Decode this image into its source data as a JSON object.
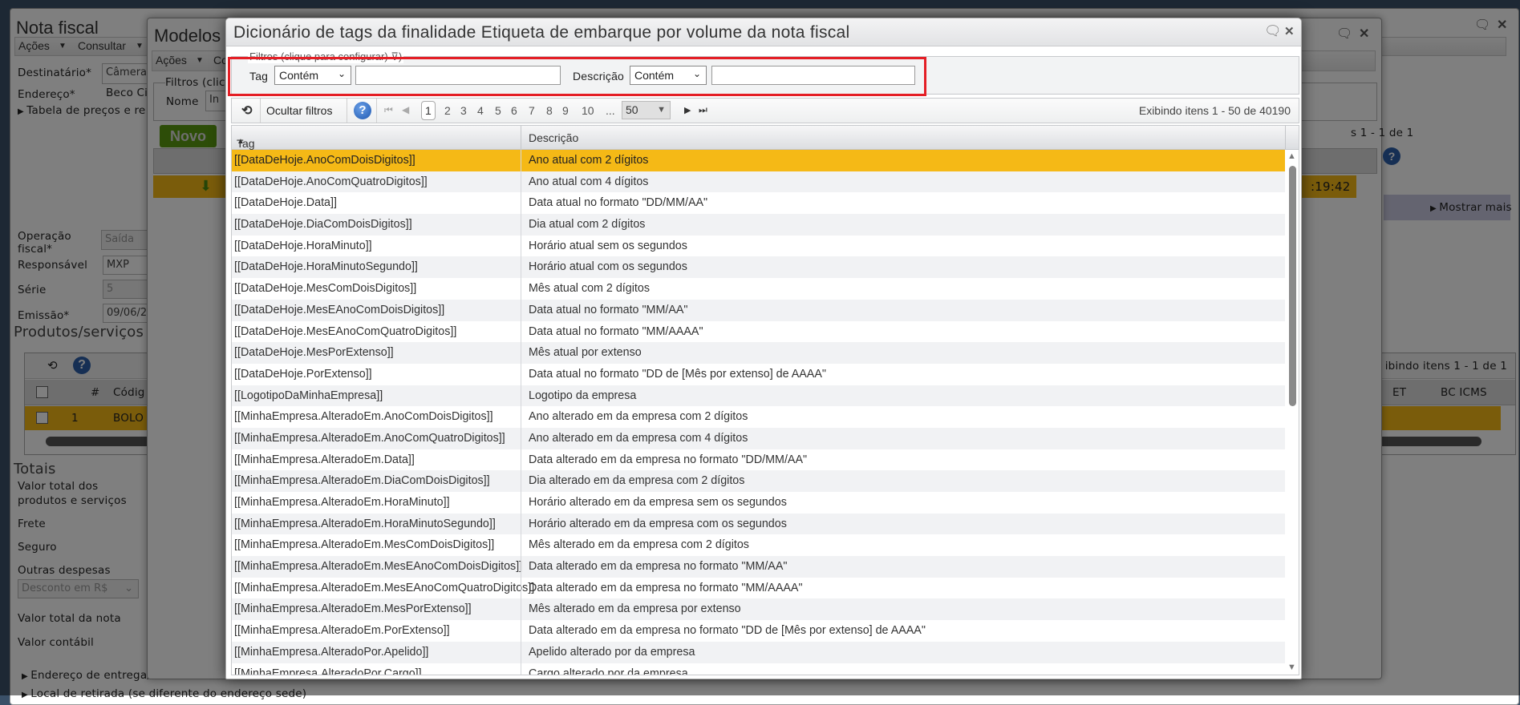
{
  "nota_fiscal": {
    "title": "Nota fiscal",
    "menu": [
      "Ações",
      "Consultar"
    ],
    "fields": {
      "destinatario_label": "Destinatário*",
      "destinatario_value": "Câmera",
      "endereco_label": "Endereço*",
      "endereco_value": "Beco Ci",
      "tabela_precos": "Tabela de preços e re",
      "operacao_label_1": "Operação",
      "operacao_label_2": "fiscal*",
      "operacao_value": "Saída",
      "responsavel_label": "Responsável",
      "responsavel_value": "MXP",
      "serie_label": "Série",
      "serie_value": "5",
      "emissao_label": "Emissão*",
      "emissao_value": "09/06/2"
    },
    "produtos": {
      "title": "Produtos/serviços",
      "col_num": "#",
      "col_codigo": "Códig",
      "row_num": "1",
      "row_codigo": "BOLO",
      "count": "ibindo itens 1 - 1 de 1",
      "col_et": "ET",
      "col_bc_icms": "BC ICMS"
    },
    "mostrar_mais": "Mostrar mais",
    "totais": {
      "title": "Totais",
      "valor_produtos_1": "Valor total dos",
      "valor_produtos_2": "produtos e serviços",
      "frete": "Frete",
      "seguro": "Seguro",
      "outras": "Outras despesas",
      "desconto": "Desconto em R$",
      "valor_nota": "Valor total da nota",
      "valor_contabil": "Valor contábil"
    },
    "endereco_entrega": "Endereço de entrega/",
    "local_retirada": "Local de retirada (se diferente do endereço sede)"
  },
  "modelos": {
    "title": "Modelos",
    "menu": [
      "Ações",
      "Co"
    ],
    "filtros": "Filtros (clic",
    "nome_label": "Nome",
    "nome_value": "In",
    "novo": "Novo",
    "count": "s 1 - 1 de 1",
    "time": ":19:42"
  },
  "dialog": {
    "title": "Dicionário de tags da finalidade Etiqueta de embarque por volume da nota fiscal",
    "filters_legend": "Filtros (clique para configurar)",
    "tag_label": "Tag",
    "tag_operator": "Contém",
    "tag_value": "",
    "desc_label": "Descrição",
    "desc_operator": "Contém",
    "desc_value": "",
    "hide_filters": "Ocultar filtros",
    "pages": [
      "1",
      "2",
      "3",
      "4",
      "5",
      "6",
      "7",
      "8",
      "9",
      "10",
      "..."
    ],
    "current_page": "1",
    "page_size": "50",
    "items_info": "Exibindo itens 1 - 50 de 40190",
    "col_tag": "Tag",
    "col_desc": "Descrição",
    "selected_color": "#f5b916",
    "rows": [
      [
        "[[DataDeHoje.AnoComDoisDigitos]]",
        "Ano atual com 2 dígitos"
      ],
      [
        "[[DataDeHoje.AnoComQuatroDigitos]]",
        "Ano atual com 4 dígitos"
      ],
      [
        "[[DataDeHoje.Data]]",
        "Data atual no formato \"DD/MM/AA\""
      ],
      [
        "[[DataDeHoje.DiaComDoisDigitos]]",
        "Dia atual com 2 dígitos"
      ],
      [
        "[[DataDeHoje.HoraMinuto]]",
        "Horário atual sem os segundos"
      ],
      [
        "[[DataDeHoje.HoraMinutoSegundo]]",
        "Horário atual com os segundos"
      ],
      [
        "[[DataDeHoje.MesComDoisDigitos]]",
        "Mês atual com 2 dígitos"
      ],
      [
        "[[DataDeHoje.MesEAnoComDoisDigitos]]",
        "Data atual no formato \"MM/AA\""
      ],
      [
        "[[DataDeHoje.MesEAnoComQuatroDigitos]]",
        "Data atual no formato \"MM/AAAA\""
      ],
      [
        "[[DataDeHoje.MesPorExtenso]]",
        "Mês atual por extenso"
      ],
      [
        "[[DataDeHoje.PorExtenso]]",
        "Data atual no formato \"DD de [Mês por extenso] de AAAA\""
      ],
      [
        "[[LogotipoDaMinhaEmpresa]]",
        "Logotipo da empresa"
      ],
      [
        "[[MinhaEmpresa.AlteradoEm.AnoComDoisDigitos]]",
        "Ano alterado em da empresa com 2 dígitos"
      ],
      [
        "[[MinhaEmpresa.AlteradoEm.AnoComQuatroDigitos]]",
        "Ano alterado em da empresa com 4 dígitos"
      ],
      [
        "[[MinhaEmpresa.AlteradoEm.Data]]",
        "Data alterado em da empresa no formato \"DD/MM/AA\""
      ],
      [
        "[[MinhaEmpresa.AlteradoEm.DiaComDoisDigitos]]",
        "Dia alterado em da empresa com 2 dígitos"
      ],
      [
        "[[MinhaEmpresa.AlteradoEm.HoraMinuto]]",
        "Horário alterado em da empresa sem os segundos"
      ],
      [
        "[[MinhaEmpresa.AlteradoEm.HoraMinutoSegundo]]",
        "Horário alterado em da empresa com os segundos"
      ],
      [
        "[[MinhaEmpresa.AlteradoEm.MesComDoisDigitos]]",
        "Mês alterado em da empresa com 2 dígitos"
      ],
      [
        "[[MinhaEmpresa.AlteradoEm.MesEAnoComDoisDigitos]]",
        "Data alterado em da empresa no formato \"MM/AA\""
      ],
      [
        "[[MinhaEmpresa.AlteradoEm.MesEAnoComQuatroDigitos]]",
        "Data alterado em da empresa no formato \"MM/AAAA\""
      ],
      [
        "[[MinhaEmpresa.AlteradoEm.MesPorExtenso]]",
        "Mês alterado em da empresa por extenso"
      ],
      [
        "[[MinhaEmpresa.AlteradoEm.PorExtenso]]",
        "Data alterado em da empresa no formato \"DD de [Mês por extenso] de AAAA\""
      ],
      [
        "[[MinhaEmpresa.AlteradoPor.Apelido]]",
        "Apelido alterado por da empresa"
      ],
      [
        "[[MinhaEmpresa.AlteradoPor.Cargo]]",
        "Cargo alterado por da empresa"
      ]
    ]
  }
}
